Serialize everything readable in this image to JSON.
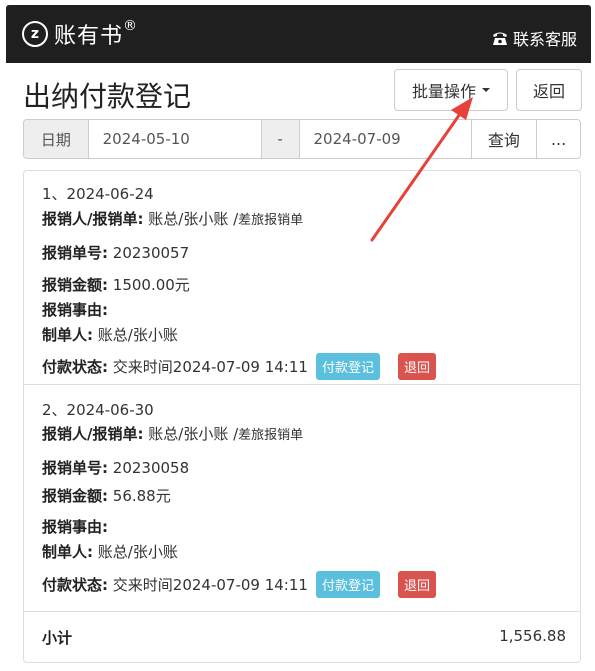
{
  "header": {
    "brand_logo_text": "z",
    "brand_name": "账有书",
    "brand_reg": "®",
    "contact_label": "联系客服"
  },
  "page": {
    "title": "出纳付款登记",
    "batch_button": "批量操作",
    "back_button": "返回"
  },
  "filter": {
    "date_label": "日期",
    "start_date": "2024-05-10",
    "separator": "-",
    "end_date": "2024-07-09",
    "query_button": "查询",
    "more_button": "..."
  },
  "records": [
    {
      "index_date": "1、2024-06-24",
      "claimant_label": "报销人/报销单:",
      "claimant_value": "账总/张小账 / ",
      "claim_type": "差旅报销单",
      "number_label": "报销单号:",
      "number_value": "20230057",
      "amount_label": "报销金额:",
      "amount_value": "1500.00元",
      "reason_label": "报销事由:",
      "reason_value": "",
      "maker_label": "制单人:",
      "maker_value": "账总/张小账",
      "status_label": "付款状态:",
      "status_value": "交来时间2024-07-09 14:11",
      "pay_badge": "付款登记",
      "return_badge": "退回"
    },
    {
      "index_date": "2、2024-06-30",
      "claimant_label": "报销人/报销单:",
      "claimant_value": "账总/张小账 / ",
      "claim_type": "差旅报销单",
      "number_label": "报销单号:",
      "number_value": "20230058",
      "amount_label": "报销金额:",
      "amount_value": "56.88元",
      "reason_label": "报销事由:",
      "reason_value": "",
      "maker_label": "制单人:",
      "maker_value": "账总/张小账",
      "status_label": "付款状态:",
      "status_value": "交来时间2024-07-09 14:11",
      "pay_badge": "付款登记",
      "return_badge": "退回"
    }
  ],
  "subtotal": {
    "label": "小计",
    "value": "1,556.88"
  },
  "colors": {
    "topbar": "#1f1f1f",
    "pay_badge": "#5bc0de",
    "return_badge": "#d9534f",
    "annotation_arrow": "#e8403a"
  }
}
